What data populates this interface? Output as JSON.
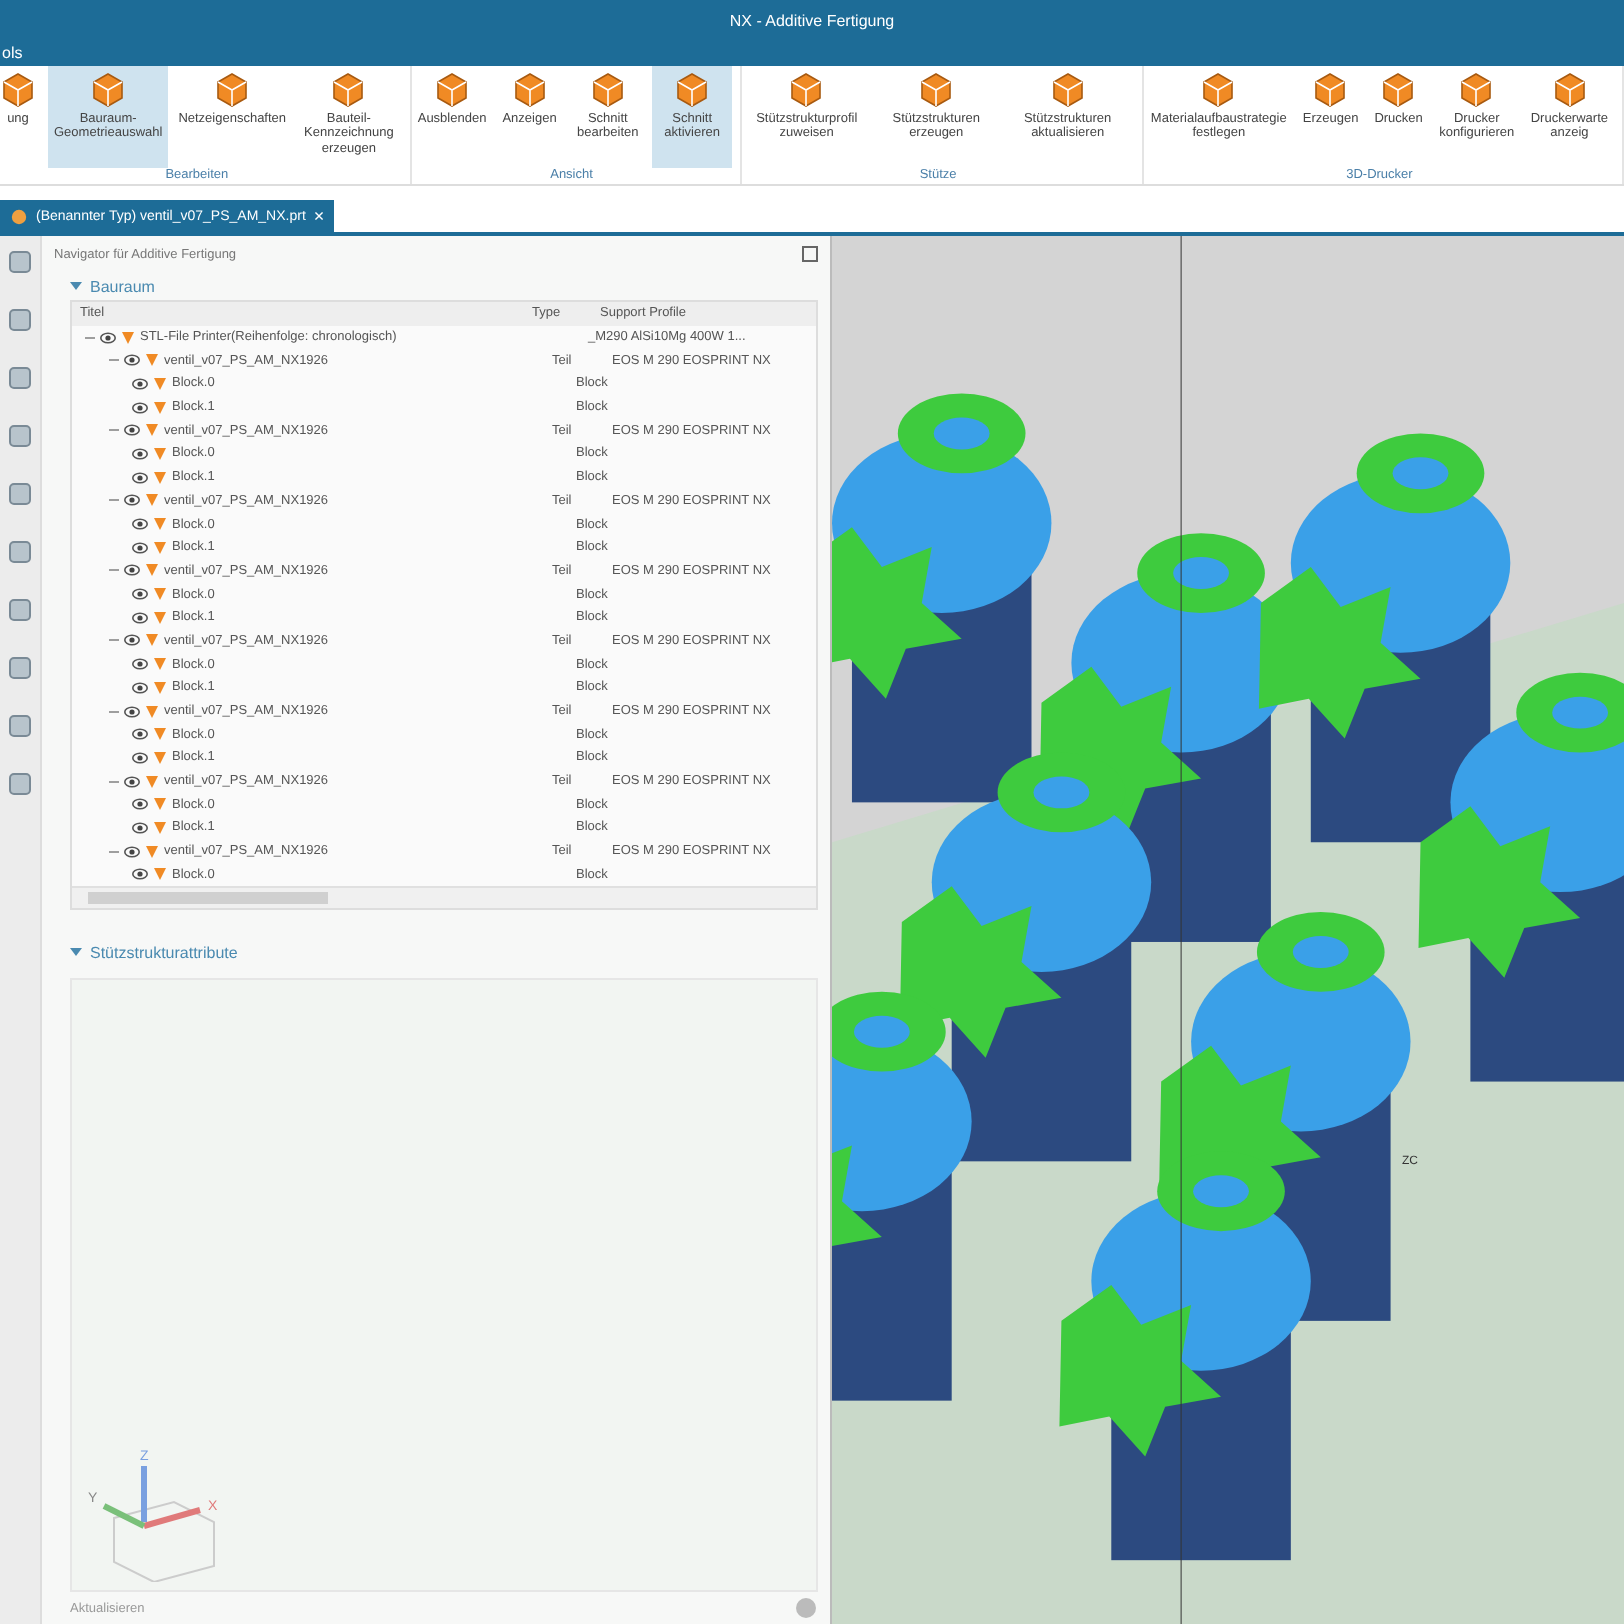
{
  "window": {
    "title": "NX - Additive Fertigung"
  },
  "menu": {
    "label": "ols"
  },
  "ribbon": {
    "groups": [
      {
        "label": "Bearbeiten",
        "buttons": [
          {
            "label": "ung",
            "selected": false
          },
          {
            "label": "Bauraum-Geometrieauswahl",
            "selected": true
          },
          {
            "label": "Netzeigenschaften",
            "selected": false
          },
          {
            "label": "Bauteil-Kennzeichnung erzeugen",
            "selected": false
          }
        ]
      },
      {
        "label": "Ansicht",
        "buttons": [
          {
            "label": "Ausblenden",
            "selected": false
          },
          {
            "label": "Anzeigen",
            "selected": false
          },
          {
            "label": "Schnitt bearbeiten",
            "selected": false
          },
          {
            "label": "Schnitt aktivieren",
            "selected": true
          }
        ]
      },
      {
        "label": "Stütze",
        "buttons": [
          {
            "label": "Stützstrukturprofil zuweisen",
            "selected": false
          },
          {
            "label": "Stützstrukturen erzeugen",
            "selected": false
          },
          {
            "label": "Stützstrukturen aktualisieren",
            "selected": false
          }
        ]
      },
      {
        "label": "3D-Drucker",
        "buttons": [
          {
            "label": "Materialaufbaustrategie festlegen",
            "selected": false
          },
          {
            "label": "Erzeugen",
            "selected": false
          },
          {
            "label": "Drucken",
            "selected": false
          },
          {
            "label": "Drucker konfigurieren",
            "selected": false
          },
          {
            "label": "Druckerwarte anzeig",
            "selected": false
          }
        ]
      }
    ]
  },
  "document_tab": {
    "label": "(Benannter Typ) ventil_v07_PS_AM_NX.prt",
    "close": "×"
  },
  "navigator": {
    "title": "Navigator für Additive Fertigung",
    "section": "Bauraum",
    "columns": [
      "Titel",
      "Type",
      "Support Profile"
    ],
    "tree": [
      {
        "title": "STL-File Printer(Reihenfolge: chronologisch)",
        "profile": "_M290 AlSi10Mg 400W 1...",
        "expanded": true,
        "children": [
          {
            "title": "ventil_v07_PS_AM_NX1926",
            "type": "Teil",
            "profile": "EOS M 290 EOSPRINT NX",
            "expanded": true,
            "children": [
              {
                "title": "Block.0",
                "type": "Block"
              },
              {
                "title": "Block.1",
                "type": "Block"
              }
            ]
          },
          {
            "title": "ventil_v07_PS_AM_NX1926",
            "type": "Teil",
            "profile": "EOS M 290 EOSPRINT NX",
            "expanded": true,
            "children": [
              {
                "title": "Block.0",
                "type": "Block"
              },
              {
                "title": "Block.1",
                "type": "Block"
              }
            ]
          },
          {
            "title": "ventil_v07_PS_AM_NX1926",
            "type": "Teil",
            "profile": "EOS M 290 EOSPRINT NX",
            "expanded": true,
            "children": [
              {
                "title": "Block.0",
                "type": "Block"
              },
              {
                "title": "Block.1",
                "type": "Block"
              }
            ]
          },
          {
            "title": "ventil_v07_PS_AM_NX1926",
            "type": "Teil",
            "profile": "EOS M 290 EOSPRINT NX",
            "expanded": true,
            "children": [
              {
                "title": "Block.0",
                "type": "Block"
              },
              {
                "title": "Block.1",
                "type": "Block"
              }
            ]
          },
          {
            "title": "ventil_v07_PS_AM_NX1926",
            "type": "Teil",
            "profile": "EOS M 290 EOSPRINT NX",
            "expanded": true,
            "children": [
              {
                "title": "Block.0",
                "type": "Block"
              },
              {
                "title": "Block.1",
                "type": "Block"
              }
            ]
          },
          {
            "title": "ventil_v07_PS_AM_NX1926",
            "type": "Teil",
            "profile": "EOS M 290 EOSPRINT NX",
            "expanded": true,
            "children": [
              {
                "title": "Block.0",
                "type": "Block"
              },
              {
                "title": "Block.1",
                "type": "Block"
              }
            ]
          },
          {
            "title": "ventil_v07_PS_AM_NX1926",
            "type": "Teil",
            "profile": "EOS M 290 EOSPRINT NX",
            "expanded": true,
            "children": [
              {
                "title": "Block.0",
                "type": "Block"
              },
              {
                "title": "Block.1",
                "type": "Block"
              }
            ]
          },
          {
            "title": "ventil_v07_PS_AM_NX1926",
            "type": "Teil",
            "profile": "EOS M 290 EOSPRINT NX",
            "expanded": true,
            "children": [
              {
                "title": "Block.0",
                "type": "Block"
              }
            ]
          }
        ]
      }
    ],
    "section2": "Stützstrukturattribute",
    "triad": {
      "z": "Z",
      "y": "Y",
      "x": "X"
    },
    "footer": "Aktualisieren"
  },
  "viewport": {
    "triad_label": "ZC"
  }
}
